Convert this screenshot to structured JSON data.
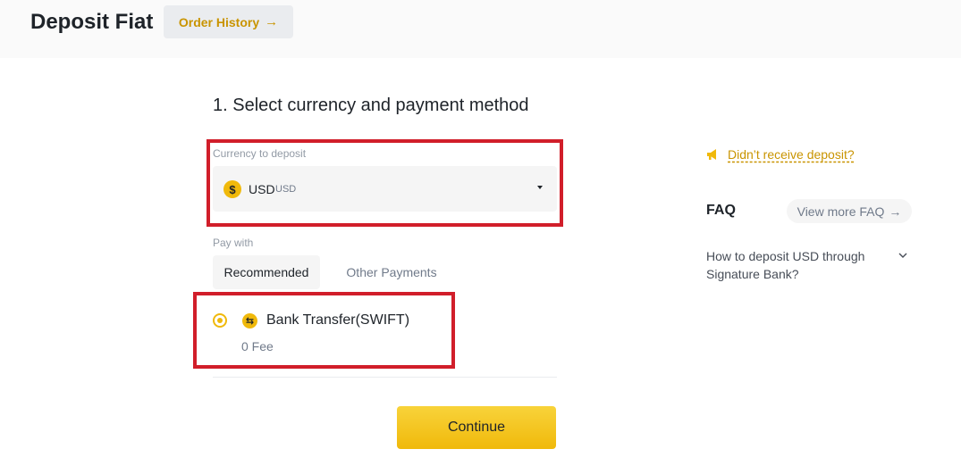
{
  "header": {
    "title": "Deposit Fiat",
    "order_history": "Order History",
    "order_history_arrow": "→"
  },
  "step": {
    "title": "1. Select currency and payment method"
  },
  "currency": {
    "label": "Currency to deposit",
    "icon": "dollar-coin-icon",
    "symbol": "$",
    "code": "USD",
    "sub": "USD"
  },
  "payment": {
    "label": "Pay with",
    "tabs": [
      {
        "label": "Recommended",
        "active": true
      },
      {
        "label": "Other Payments",
        "active": false
      }
    ],
    "method": {
      "name": "Bank Transfer(SWIFT)",
      "fee": "0 Fee",
      "selected": true
    }
  },
  "continue_label": "Continue",
  "sidebar": {
    "not_received": "Didn’t receive deposit?",
    "faq_title": "FAQ",
    "view_more_faq": "View more FAQ",
    "view_more_arrow": "→",
    "faq_question": "How to deposit USD through Signature Bank?"
  },
  "colors": {
    "accent": "#f0b90b",
    "link": "#c99400",
    "highlight_box": "#d11e2a"
  }
}
